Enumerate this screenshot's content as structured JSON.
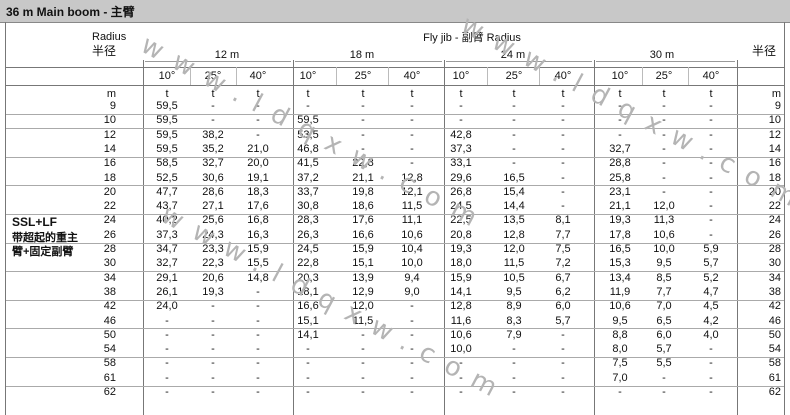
{
  "title": "36 m   Main boom - 主臂",
  "header": {
    "radius_en": "Radius",
    "radius_cn_left": "半径",
    "radius_cn_right": "半径",
    "fly_jib": "Fly jib - 副臂 Radius",
    "groups": [
      "12 m",
      "18 m",
      "24 m",
      "30 m"
    ],
    "angles": [
      "10°",
      "25°",
      "40°"
    ],
    "unit_radius": "m",
    "unit_t": "t"
  },
  "side_label": {
    "line1": "SSL+LF",
    "line2": "带超起的重主",
    "line3": "臂+固定副臂"
  },
  "watermark": "www.ldqxw.com",
  "rows": [
    {
      "r": "9",
      "v": [
        "59,5",
        "-",
        "-",
        "-",
        "-",
        "-",
        "-",
        "-",
        "-",
        "-",
        "-",
        "-"
      ]
    },
    {
      "r": "10",
      "v": [
        "59,5",
        "-",
        "-",
        "59,5",
        "-",
        "-",
        "-",
        "-",
        "-",
        "-",
        "-",
        "-"
      ]
    },
    {
      "r": "12",
      "v": [
        "59,5",
        "38,2",
        "-",
        "53,5",
        "-",
        "-",
        "42,8",
        "-",
        "-",
        "-",
        "-",
        "-"
      ]
    },
    {
      "r": "14",
      "v": [
        "59,5",
        "35,2",
        "21,0",
        "46,8",
        "-",
        "-",
        "37,3",
        "-",
        "-",
        "32,7",
        "-",
        "-"
      ]
    },
    {
      "r": "16",
      "v": [
        "58,5",
        "32,7",
        "20,0",
        "41,5",
        "22,8",
        "-",
        "33,1",
        "-",
        "-",
        "28,8",
        "-",
        "-"
      ]
    },
    {
      "r": "18",
      "v": [
        "52,5",
        "30,6",
        "19,1",
        "37,2",
        "21,1",
        "12,8",
        "29,6",
        "16,5",
        "-",
        "25,8",
        "-",
        "-"
      ]
    },
    {
      "r": "20",
      "v": [
        "47,7",
        "28,6",
        "18,3",
        "33,7",
        "19,8",
        "12,1",
        "26,8",
        "15,4",
        "-",
        "23,1",
        "-",
        "-"
      ]
    },
    {
      "r": "22",
      "v": [
        "43,7",
        "27,1",
        "17,6",
        "30,8",
        "18,6",
        "11,5",
        "24,5",
        "14,4",
        "-",
        "21,1",
        "12,0",
        "-"
      ]
    },
    {
      "r": "24",
      "v": [
        "40,2",
        "25,6",
        "16,8",
        "28,3",
        "17,6",
        "11,1",
        "22,5",
        "13,5",
        "8,1",
        "19,3",
        "11,3",
        "-"
      ]
    },
    {
      "r": "26",
      "v": [
        "37,3",
        "24,3",
        "16,3",
        "26,3",
        "16,6",
        "10,6",
        "20,8",
        "12,8",
        "7,7",
        "17,8",
        "10,6",
        "-"
      ]
    },
    {
      "r": "28",
      "v": [
        "34,7",
        "23,3",
        "15,9",
        "24,5",
        "15,9",
        "10,4",
        "19,3",
        "12,0",
        "7,5",
        "16,5",
        "10,0",
        "5,9"
      ]
    },
    {
      "r": "30",
      "v": [
        "32,7",
        "22,3",
        "15,5",
        "22,8",
        "15,1",
        "10,0",
        "18,0",
        "11,5",
        "7,2",
        "15,3",
        "9,5",
        "5,7"
      ]
    },
    {
      "r": "34",
      "v": [
        "29,1",
        "20,6",
        "14,8",
        "20,3",
        "13,9",
        "9,4",
        "15,9",
        "10,5",
        "6,7",
        "13,4",
        "8,5",
        "5,2"
      ]
    },
    {
      "r": "38",
      "v": [
        "26,1",
        "19,3",
        "-",
        "18,1",
        "12,9",
        "9,0",
        "14,1",
        "9,5",
        "6,2",
        "11,9",
        "7,7",
        "4,7"
      ]
    },
    {
      "r": "42",
      "v": [
        "24,0",
        "-",
        "-",
        "16,6",
        "12,0",
        "-",
        "12,8",
        "8,9",
        "6,0",
        "10,6",
        "7,0",
        "4,5"
      ]
    },
    {
      "r": "46",
      "v": [
        "-",
        "-",
        "-",
        "15,1",
        "11,5",
        "-",
        "11,6",
        "8,3",
        "5,7",
        "9,5",
        "6,5",
        "4,2"
      ]
    },
    {
      "r": "50",
      "v": [
        "-",
        "-",
        "-",
        "14,1",
        "-",
        "-",
        "10,6",
        "7,9",
        "-",
        "8,8",
        "6,0",
        "4,0"
      ]
    },
    {
      "r": "54",
      "v": [
        "-",
        "-",
        "-",
        "-",
        "-",
        "-",
        "10,0",
        "-",
        "-",
        "8,0",
        "5,7",
        "-"
      ]
    },
    {
      "r": "58",
      "v": [
        "-",
        "-",
        "-",
        "-",
        "-",
        "-",
        "-",
        "-",
        "-",
        "7,5",
        "5,5",
        "-"
      ]
    },
    {
      "r": "61",
      "v": [
        "-",
        "-",
        "-",
        "-",
        "-",
        "-",
        "-",
        "-",
        "-",
        "7,0",
        "-",
        "-"
      ]
    },
    {
      "r": "62",
      "v": [
        "-",
        "-",
        "-",
        "-",
        "-",
        "-",
        "-",
        "-",
        "-",
        "-",
        "-",
        "-"
      ]
    }
  ]
}
